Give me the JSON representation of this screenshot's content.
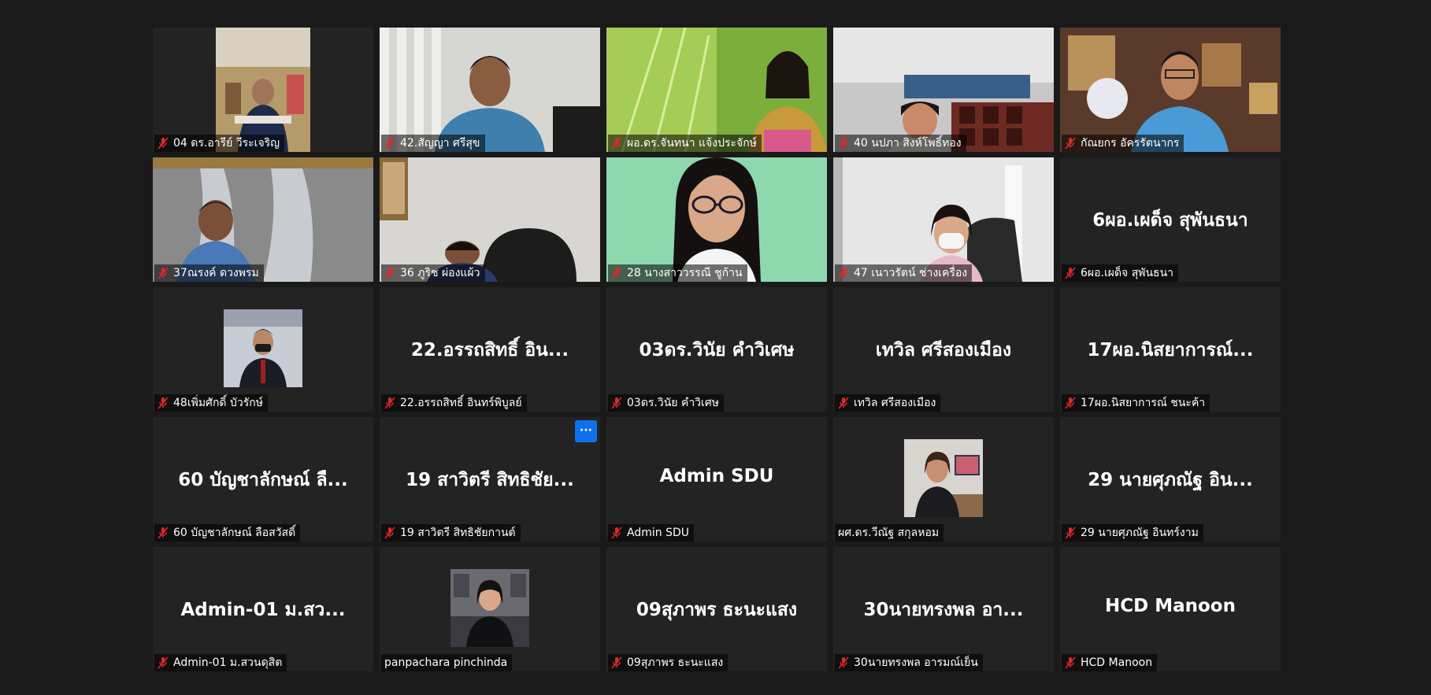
{
  "tiles": [
    {
      "name": "04 ดร.อารีย์ วีระเจริญ",
      "muted": true,
      "display": "video"
    },
    {
      "name": "42.สัญญา ศรีสุข",
      "muted": true,
      "display": "video"
    },
    {
      "name": "ผอ.ดร.จันทนา แจ้งประจักษ์",
      "muted": true,
      "display": "video"
    },
    {
      "name": "40 นปภา สิงห์โพธิ์ทอง",
      "muted": true,
      "display": "video"
    },
    {
      "name": "กัณยกร อัครรัตนากร",
      "muted": true,
      "display": "video"
    },
    {
      "name": "37ณรงค์ ดวงพรม",
      "muted": true,
      "display": "video"
    },
    {
      "name": "36 ภูริช ผ่องแผ้ว",
      "muted": true,
      "display": "video"
    },
    {
      "name": "28 นางสาววรรณี ชูก้าน",
      "muted": true,
      "display": "video"
    },
    {
      "name": "47 เนาวรัตน์ ช่างเครื่อง",
      "muted": true,
      "display": "video"
    },
    {
      "name": "6ผอ.เผด็จ สุพันธนา",
      "muted": true,
      "display": "text",
      "big_name": "6ผอ.เผด็จ สุพันธนา"
    },
    {
      "name": "48เพิ่มศักดิ์ บัวรักษ์",
      "muted": true,
      "display": "photo"
    },
    {
      "name": "22.อรรถสิทธิ์ อินทร์พิบูลย์",
      "muted": true,
      "display": "text",
      "big_name": "22.อรรถสิทธิ์ อิน..."
    },
    {
      "name": "03ดร.วินัย คำวิเศษ",
      "muted": true,
      "display": "text",
      "big_name": "03ดร.วินัย คำวิเศษ"
    },
    {
      "name": "เทวิล ศรีสองเมือง",
      "muted": true,
      "display": "text",
      "big_name": "เทวิล ศรีสองเมือง"
    },
    {
      "name": "17ผอ.นิสยาการณ์ ชนะค้า",
      "muted": true,
      "display": "text",
      "big_name": "17ผอ.นิสยาการณ์..."
    },
    {
      "name": "60 บัญชาลักษณ์ ลือสวัสดิ์",
      "muted": true,
      "display": "text",
      "big_name": "60 บัญชาลักษณ์ ลื..."
    },
    {
      "name": "19 สาวิตรี สิทธิชัยกานต์",
      "muted": true,
      "display": "text",
      "big_name": "19 สาวิตรี สิทธิชัย...",
      "more": true
    },
    {
      "name": "Admin SDU",
      "muted": true,
      "display": "text",
      "big_name": "Admin SDU"
    },
    {
      "name": "ผศ.ดร.วีณัฐ สกุลหอม",
      "muted": false,
      "display": "photo"
    },
    {
      "name": "29 นายศุภณัฐ อินทร์งาม",
      "muted": true,
      "display": "text",
      "big_name": "29 นายศุภณัฐ อิน..."
    },
    {
      "name": "Admin-01 ม.สวนดุสิต",
      "muted": true,
      "display": "text",
      "big_name": "Admin-01 ม.สว..."
    },
    {
      "name": "panpachara pinchinda",
      "muted": false,
      "display": "photo"
    },
    {
      "name": "09สุภาพร ธะนะแสง",
      "muted": true,
      "display": "text",
      "big_name": "09สุภาพร ธะนะแสง"
    },
    {
      "name": "30นายทรงพล อารมณ์เย็น",
      "muted": true,
      "display": "text",
      "big_name": "30นายทรงพล อา..."
    },
    {
      "name": "HCD Manoon",
      "muted": true,
      "display": "text",
      "big_name": "HCD Manoon"
    }
  ],
  "more_button_label": "···",
  "colors": {
    "background": "#1a1a1a",
    "tile": "#232323",
    "muted_icon": "#e02828",
    "accent": "#0e71eb"
  }
}
